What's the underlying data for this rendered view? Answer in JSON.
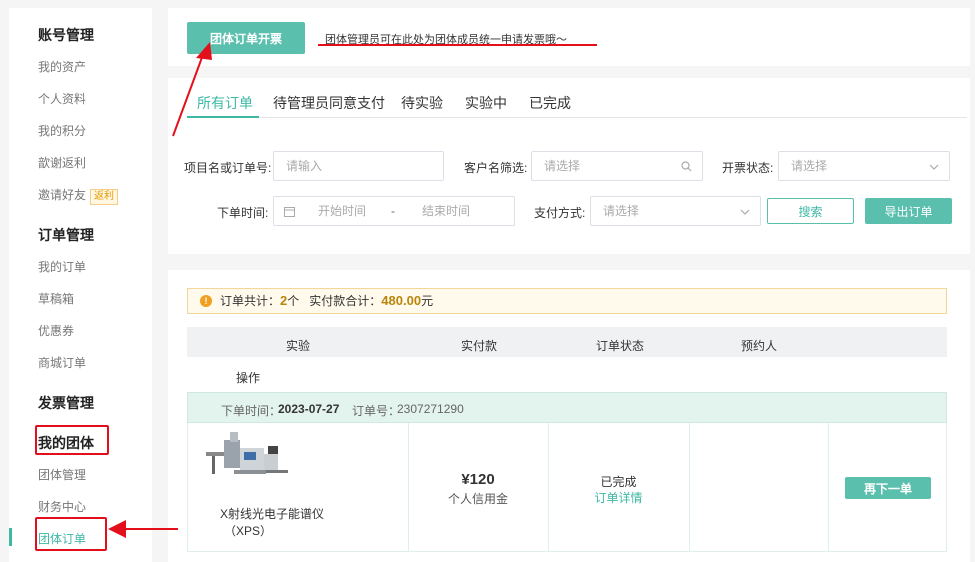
{
  "sidebar": {
    "sections": [
      {
        "title": "账号管理",
        "items": [
          "我的资产",
          "个人资料",
          "我的积分",
          "歆谢返利",
          "邀请好友"
        ]
      },
      {
        "title": "订单管理",
        "items": [
          "我的订单",
          "草稿箱",
          "优惠券",
          "商城订单"
        ]
      },
      {
        "title": "发票管理",
        "items": []
      },
      {
        "title": "我的团体",
        "items": [
          "团体管理",
          "财务中心",
          "团体订单"
        ]
      }
    ],
    "invite_badge": "返利",
    "active_item": "团体订单"
  },
  "top": {
    "group_invoice_button": "团体订单开票",
    "notice": "团体管理员可在此处为团体成员统一申请发票哦～"
  },
  "tabs": [
    "所有订单",
    "待管理员同意支付",
    "待实验",
    "实验中",
    "已完成"
  ],
  "filters": {
    "project_label": "项目名或订单号:",
    "project_placeholder": "请输入",
    "customer_label": "客户名筛选:",
    "customer_placeholder": "请选择",
    "invoice_label": "开票状态:",
    "invoice_placeholder": "请选择",
    "date_label": "下单时间:",
    "start_placeholder": "开始时间",
    "date_sep": "-",
    "end_placeholder": "结束时间",
    "pay_label": "支付方式:",
    "pay_placeholder": "请选择",
    "search_button": "搜索",
    "export_button": "导出订单"
  },
  "summary": {
    "count_label": "订单共计：",
    "count": "2",
    "count_unit": "个",
    "amount_label": "实付款合计：",
    "amount": "480.00",
    "amount_unit": "元"
  },
  "table": {
    "headers": [
      "实验",
      "实付款",
      "订单状态",
      "预约人",
      "操作"
    ]
  },
  "order": {
    "time_label": "下单时间：",
    "time": "2023-07-27",
    "no_label": "订单号：",
    "no": "2307271290",
    "product_name": "X射线光电子能谱仪",
    "product_sub": "（XPS）",
    "price": "¥120",
    "pay_method": "个人信用金",
    "status": "已完成",
    "detail_link": "订单详情",
    "reorder_button": "再下一单"
  },
  "colors": {
    "accent": "#5bbfae",
    "annotation": "#e3101c"
  }
}
